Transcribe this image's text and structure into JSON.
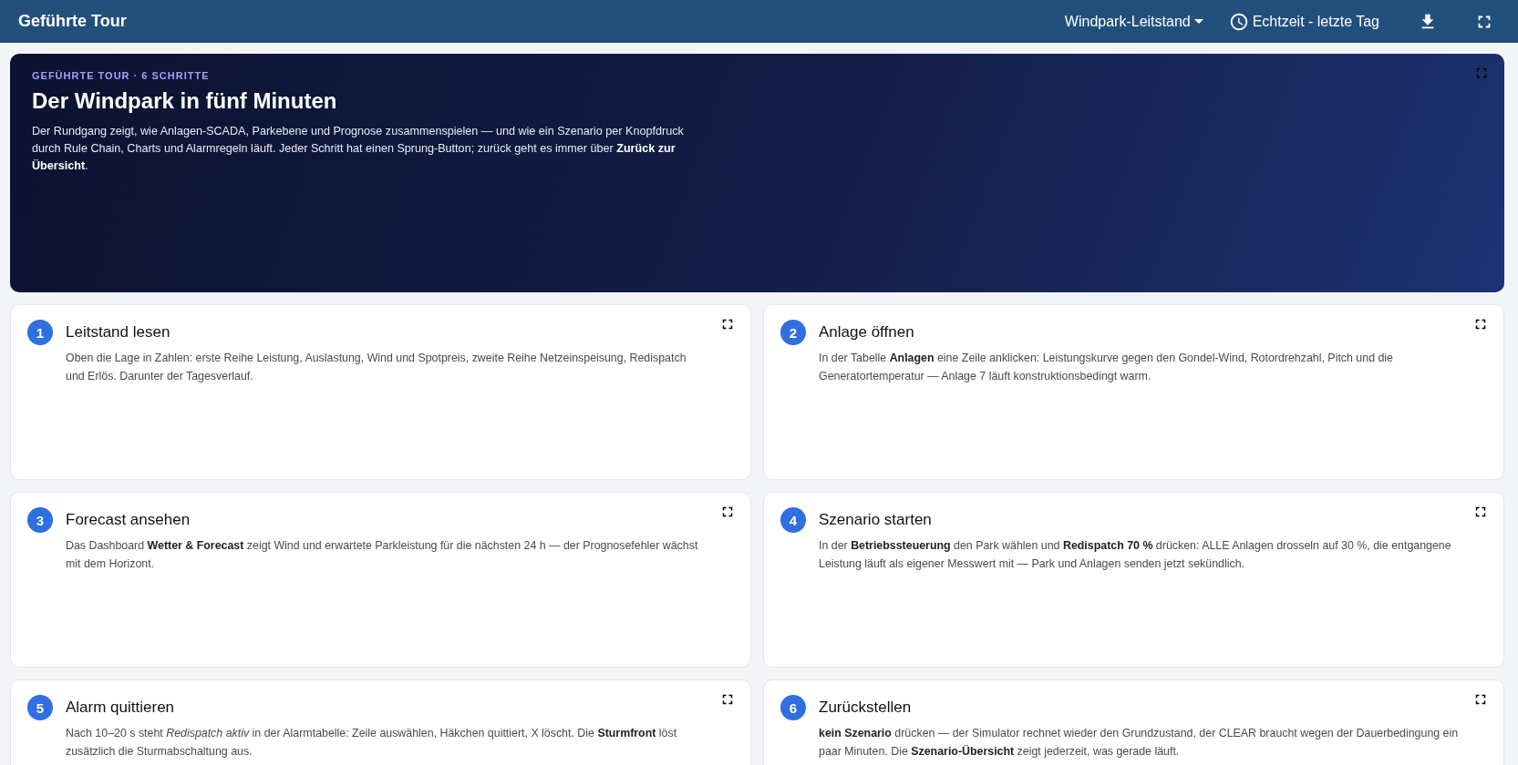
{
  "header": {
    "title": "Geführte Tour",
    "dashboard_selector": "Windpark-Leitstand",
    "time_window": "Echtzeit - letzte Tag"
  },
  "hero": {
    "eyebrow": "GEFÜHRTE TOUR · 6 SCHRITTE",
    "title": "Der Windpark in fünf Minuten",
    "text": "Der Rundgang zeigt, wie Anlagen-SCADA, Parkebene und Prognose zusammenspielen — und wie ein Szenario per Knopfdruck durch Rule Chain, Charts und Alarmregeln läuft. Jeder Schritt hat einen Sprung-Button; zurück geht es immer über **Zurück zur Übersicht**."
  },
  "steps": [
    {
      "number": "1",
      "title": "Leitstand lesen",
      "text": "Oben die Lage in Zahlen: erste Reihe Leistung, Auslastung, Wind und Spotpreis, zweite Reihe Netzeinspeisung, Redispatch und Erlös. Darunter der Tagesverlauf."
    },
    {
      "number": "2",
      "title": "Anlage öffnen",
      "text": "In der Tabelle **Anlagen** eine Zeile anklicken: Leistungskurve gegen den Gondel-Wind, Rotordrehzahl, Pitch und die Generatortemperatur — Anlage 7 läuft konstruktionsbedingt warm."
    },
    {
      "number": "3",
      "title": "Forecast ansehen",
      "text": "Das Dashboard **Wetter & Forecast** zeigt Wind und erwartete Parkleistung für die nächsten 24 h — der Prognosefehler wächst mit dem Horizont."
    },
    {
      "number": "4",
      "title": "Szenario starten",
      "text": "In der **Betriebssteuerung** den Park wählen und **Redispatch 70 %** drücken: ALLE Anlagen drosseln auf 30 %, die entgangene Leistung läuft als eigener Messwert mit — Park und Anlagen senden jetzt sekündlich."
    },
    {
      "number": "5",
      "title": "Alarm quittieren",
      "text": "Nach 10–20 s steht *Redispatch aktiv* in der Alarmtabelle: Zeile auswählen, Häkchen quittiert, X löscht. Die **Sturmfront** löst zusätzlich die Sturmabschaltung aus."
    },
    {
      "number": "6",
      "title": "Zurückstellen",
      "text": "**kein Szenario** drücken — der Simulator rechnet wieder den Grundzustand, der CLEAR braucht wegen der Dauerbedingung ein paar Minuten. Die **Szenario-Übersicht** zeigt jederzeit, was gerade läuft."
    }
  ]
}
